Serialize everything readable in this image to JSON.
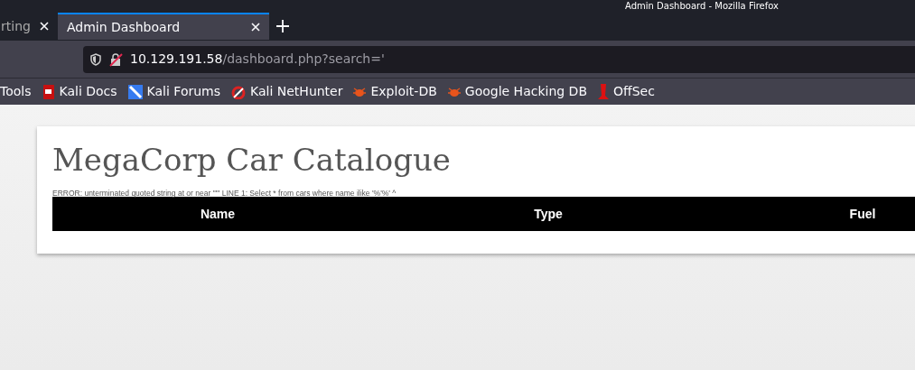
{
  "window": {
    "title": "Admin Dashboard - Mozilla Firefox"
  },
  "tabs": [
    {
      "label": "rting",
      "selected": false
    },
    {
      "label": "Admin Dashboard",
      "selected": true
    }
  ],
  "address_bar": {
    "host": "10.129.191.58",
    "path": "/dashboard.php?search='"
  },
  "bookmarks": [
    {
      "label": "Tools",
      "kind": "none"
    },
    {
      "label": "Kali Docs",
      "kind": "docs"
    },
    {
      "label": "Kali Forums",
      "kind": "forums"
    },
    {
      "label": "Kali NetHunter",
      "kind": "nethunter"
    },
    {
      "label": "Exploit-DB",
      "kind": "bug"
    },
    {
      "label": "Google Hacking DB",
      "kind": "bug"
    },
    {
      "label": "OffSec",
      "kind": "offsec"
    }
  ],
  "page": {
    "heading": "MegaCorp Car Catalogue",
    "error": "ERROR: unterminated quoted string at or near \"'\" LINE 1: Select * from cars where name ilike '%'%' ^",
    "table": {
      "columns": [
        "Name",
        "Type",
        "Fuel"
      ]
    }
  }
}
